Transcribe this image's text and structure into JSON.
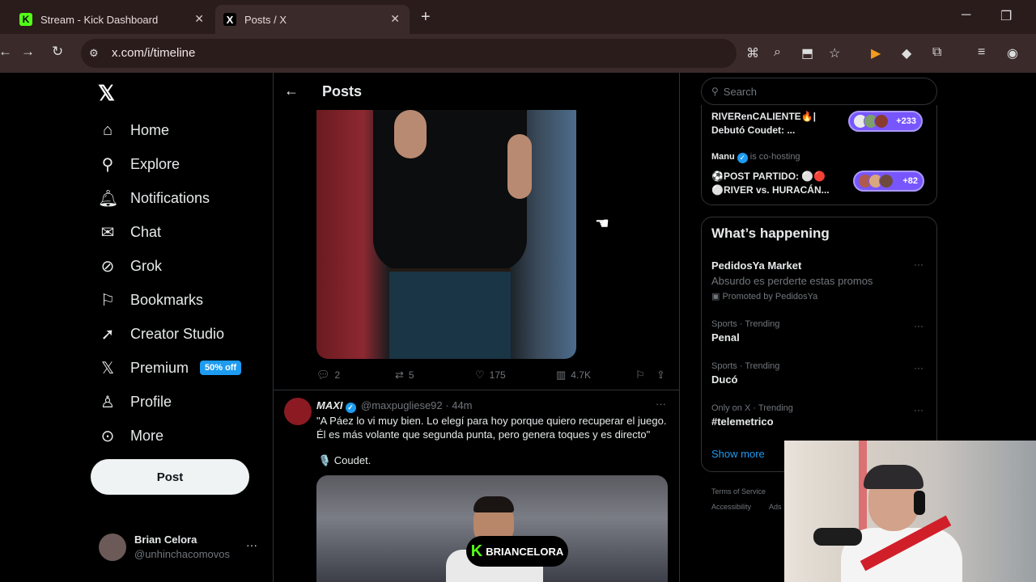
{
  "browser": {
    "tabs": [
      {
        "title": "Stream - Kick Dashboard",
        "favicon": "K"
      },
      {
        "title": "Posts / X",
        "favicon": "X"
      }
    ],
    "url": "x.com/i/timeline"
  },
  "leftnav": {
    "items": [
      {
        "label": "Home",
        "icon": "home-icon"
      },
      {
        "label": "Explore",
        "icon": "search-icon"
      },
      {
        "label": "Notifications",
        "icon": "bell-icon"
      },
      {
        "label": "Chat",
        "icon": "mail-icon"
      },
      {
        "label": "Grok",
        "icon": "grok-icon"
      },
      {
        "label": "Bookmarks",
        "icon": "bookmark-icon"
      },
      {
        "label": "Creator Studio",
        "icon": "rocket-icon"
      },
      {
        "label": "Premium",
        "icon": "x-logo-icon"
      },
      {
        "label": "Profile",
        "icon": "person-icon"
      },
      {
        "label": "More",
        "icon": "more-circle-icon"
      }
    ],
    "premium_badge": "50% off",
    "post_button": "Post",
    "account": {
      "name": "Brian Celora",
      "handle": "@unhinchacomovos"
    }
  },
  "main": {
    "title": "Posts",
    "post1_stats": {
      "replies": "2",
      "reposts": "5",
      "likes": "175",
      "views": "4.7K"
    },
    "post2": {
      "author": "MAXI",
      "handle": "@maxpugliese92",
      "time": "· 44m",
      "text": "\"A Páez lo vi muy bien. Lo elegí para hoy porque quiero recuperar el juego. Él es más volante que segunda punta, pero genera toques y es directo\"",
      "subtext": "🎙️ Coudet."
    }
  },
  "overlay": {
    "kick_user": "BRIANCELORA"
  },
  "sidebar": {
    "search_placeholder": "Search",
    "spaces": [
      {
        "title_line1": "RIVERenCALIENTE🔥|",
        "title_line2": "Debutó Coudet: ...",
        "count": "+233"
      },
      {
        "host": "Manu",
        "host_suffix": "is co-hosting",
        "title_line1": "⚽POST PARTIDO: ⚪🔴",
        "title_line2": "⚪RIVER vs. HURACÁN...",
        "count": "+82"
      }
    ],
    "whats_happening": {
      "title": "What’s happening",
      "promo": {
        "name": "PedidosYa Market",
        "desc": "Absurdo es perderte estas promos",
        "promoted": "Promoted by PedidosYa"
      },
      "trends": [
        {
          "meta": "Sports · Trending",
          "name": "Penal"
        },
        {
          "meta": "Sports · Trending",
          "name": "Ducó"
        },
        {
          "meta": "Only on X · Trending",
          "name": "#telemetrico"
        }
      ],
      "show_more": "Show more"
    },
    "footer": [
      "Terms of Service",
      "Accessibility",
      "Ads"
    ]
  }
}
